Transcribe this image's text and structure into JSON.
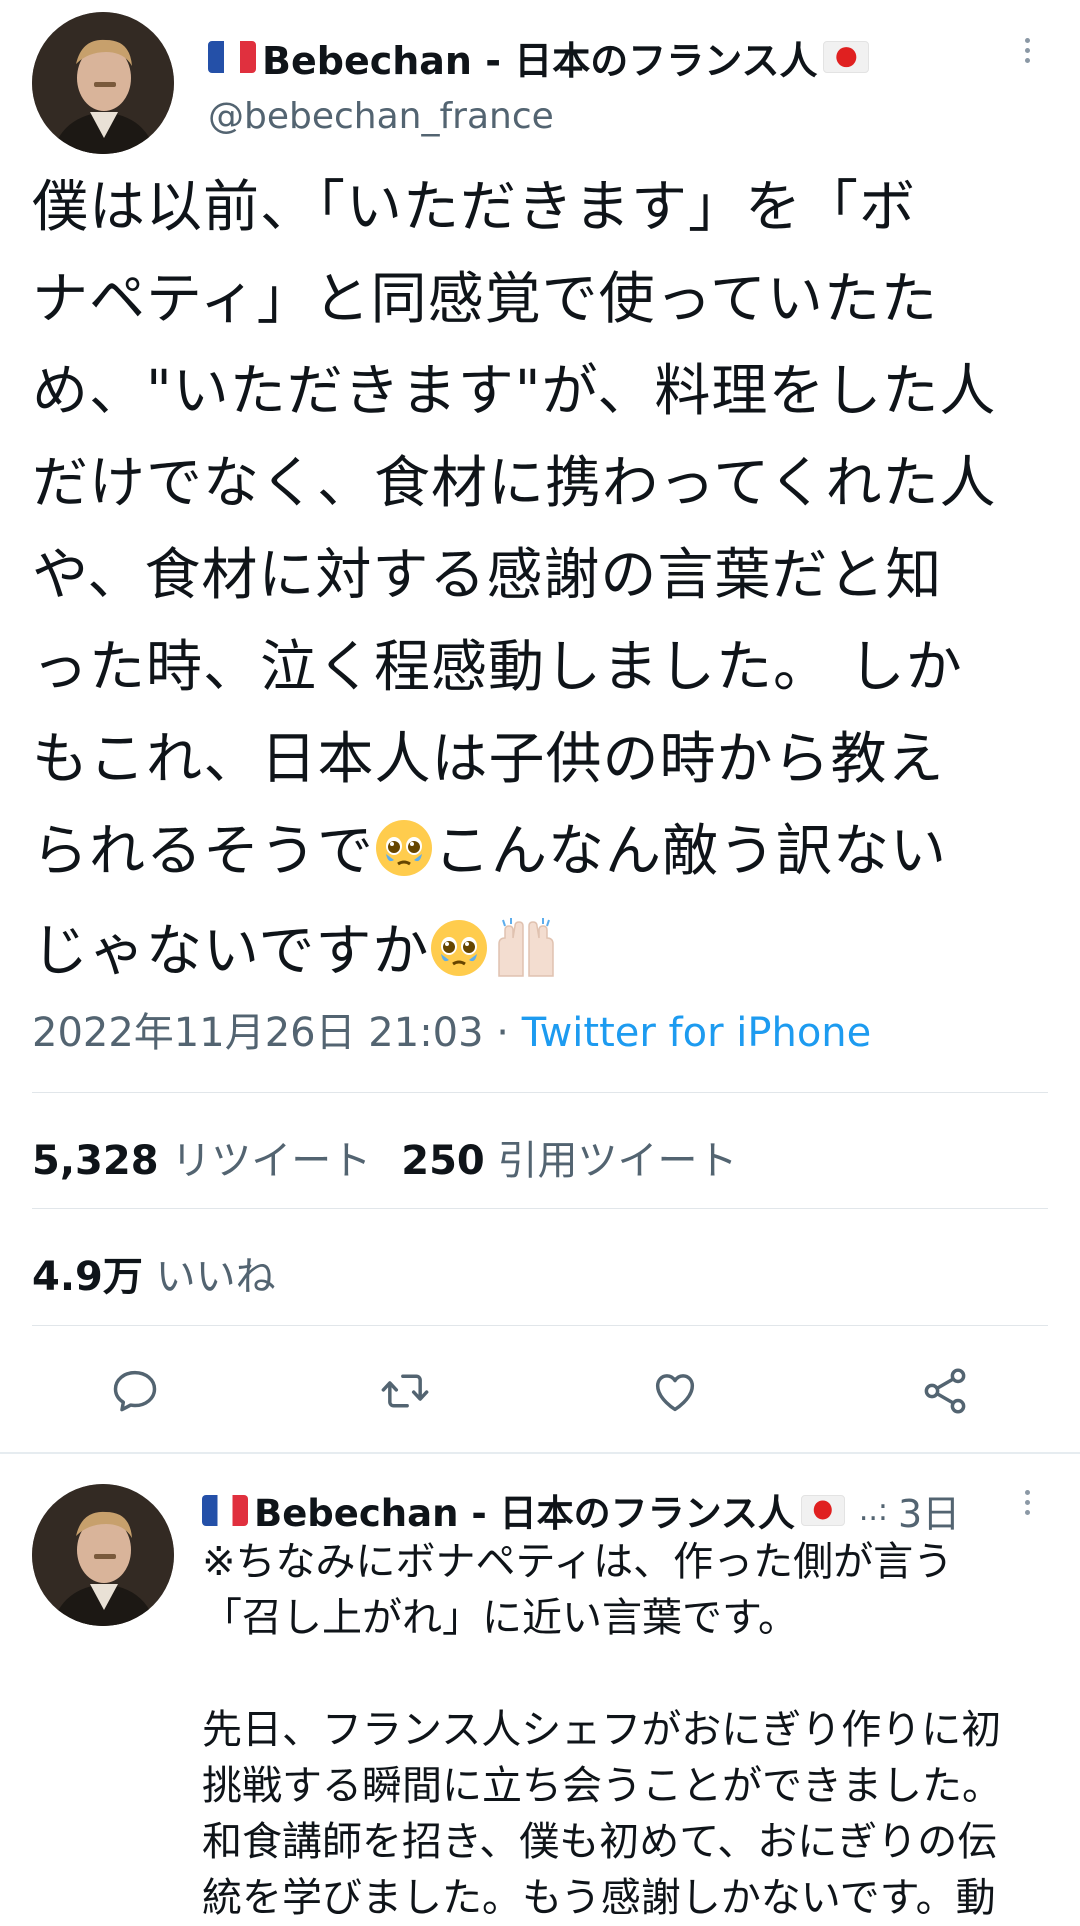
{
  "main_tweet": {
    "display_name": "Bebechan - 日本のフランス人",
    "handle": "@bebechan_france",
    "text_lines": [
      "僕は以前、「いただきます」を「ボ",
      "ナペティ」と同感覚で使っていたた",
      "め、\"いただきます\"が、料理をした人",
      "だけでなく、食材に携わってくれた人",
      "や、食材に対する感謝の言葉だと知",
      "った時、泣く程感動しました。 しか",
      "もこれ、日本人は子供の時から教え",
      "られるそうで",
      "こんなん敵う訳ない",
      "じゃないですか"
    ],
    "timestamp": "2022年11月26日 21:03",
    "separator": " · ",
    "source": "Twitter for iPhone",
    "stats": {
      "retweet_count": "5,328",
      "retweet_label": "リツイート",
      "quote_count": "250",
      "quote_label": "引用ツイート",
      "like_count": "4.9万",
      "like_label": "いいね"
    }
  },
  "reply_tweet": {
    "display_name": "Bebechan - 日本のフランス人",
    "truncation": "..:",
    "time_ago": "3日",
    "text_lines": [
      "※ちなみにボナペティは、作った側が言う",
      "「召し上がれ」に近い言葉です。",
      "",
      "先日、フランス人シェフがおにぎり作りに初",
      "挑戦する瞬間に立ち会うことができました。",
      "和食講師を招き、僕も初めて、おにぎりの伝",
      "統を学びました。もう感謝しかないです。動"
    ]
  },
  "icons": {
    "reply": "reply-icon",
    "retweet": "retweet-icon",
    "like": "heart-icon",
    "share": "share-icon",
    "more": "more-vertical-icon",
    "flag_france": "flag-france-icon",
    "flag_japan": "flag-japan-icon",
    "emoji_pleading": "pleading-face-emoji",
    "emoji_raised_hands": "raising-hands-emoji"
  },
  "colors": {
    "text": "#0f1419",
    "secondary": "#536471",
    "link": "#1d9bf0",
    "divider": "#e1e6ea"
  }
}
